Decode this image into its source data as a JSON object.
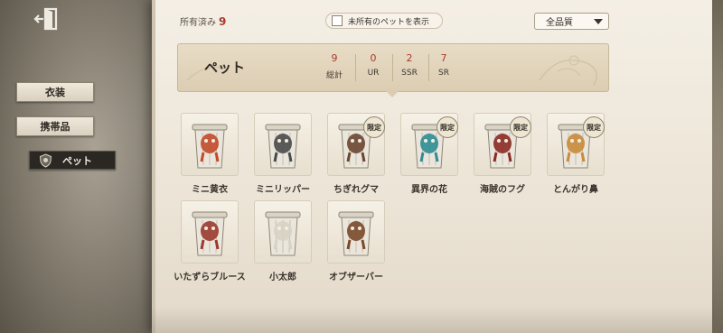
{
  "sidebar": {
    "items": [
      {
        "label": "衣装",
        "active": false
      },
      {
        "label": "携帯品",
        "active": false
      },
      {
        "label": "ペット",
        "active": true
      }
    ]
  },
  "topbar": {
    "owned_label": "所有済み",
    "owned_count": "9",
    "show_unowned_label": "未所有のペットを表示",
    "quality_select": "全品質"
  },
  "header": {
    "title": "ペット",
    "stats": [
      {
        "value": "9",
        "label": "総計"
      },
      {
        "value": "0",
        "label": "UR"
      },
      {
        "value": "2",
        "label": "SSR"
      },
      {
        "value": "7",
        "label": "SR"
      }
    ]
  },
  "pets": [
    {
      "name": "ミニ黄衣",
      "limited": false,
      "icon": "yellow-robe-pet-icon",
      "color": "#c24a2a"
    },
    {
      "name": "ミニリッパー",
      "limited": false,
      "icon": "ripper-pet-icon",
      "color": "#4a4a4a"
    },
    {
      "name": "ちぎれグマ",
      "limited": true,
      "icon": "torn-bear-pet-icon",
      "color": "#6b4630"
    },
    {
      "name": "異界の花",
      "limited": true,
      "icon": "otherworld-flower-pet-icon",
      "color": "#2f8d93"
    },
    {
      "name": "海賊のフグ",
      "limited": true,
      "icon": "pirate-pufferfish-pet-icon",
      "color": "#8a2b24"
    },
    {
      "name": "とんがり鼻",
      "limited": true,
      "icon": "pointy-nose-pet-icon",
      "color": "#c98a3a"
    },
    {
      "name": "いたずらブルース",
      "limited": false,
      "icon": "prank-bruce-pet-icon",
      "color": "#9a3a2c"
    },
    {
      "name": "小太郎",
      "limited": false,
      "icon": "kotaro-pet-icon",
      "color": "#d8d2c4"
    },
    {
      "name": "オブザーバー",
      "limited": false,
      "icon": "observer-pet-icon",
      "color": "#7a4a2a"
    }
  ],
  "limited_label": "限定"
}
